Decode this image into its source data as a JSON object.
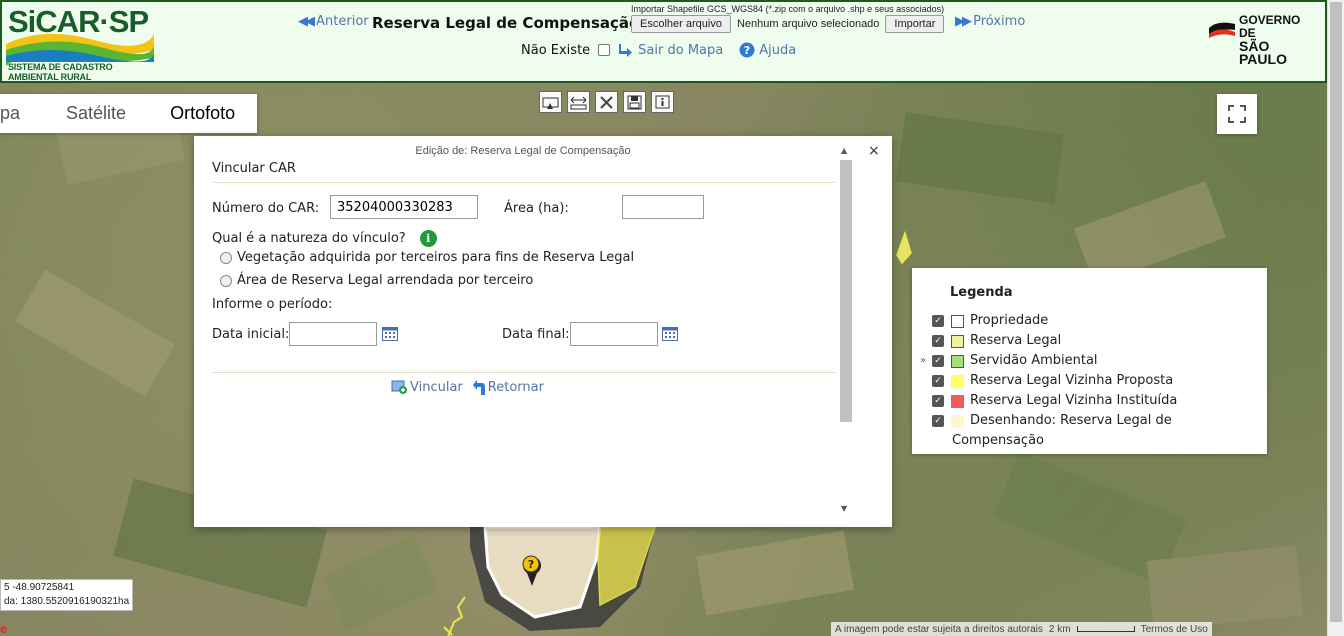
{
  "header": {
    "logo_title": "SiCAR·SP",
    "logo_subtitle": "SISTEMA DE CADASTRO AMBIENTAL RURAL",
    "anterior_label": "Anterior",
    "page_title": "Reserva Legal de Compensação",
    "import_hint": "Importar Shapefile GCS_WGS84 (*.zip com o arquivo .shp e seus associados)",
    "choose_file_label": "Escolher arquivo",
    "file_status": "Nenhum arquivo selecionado",
    "import_label": "Importar",
    "proximo_label": "Próximo",
    "nao_existe_label": "Não Existe",
    "sair_label": "Sair do Mapa",
    "ajuda_label": "Ajuda",
    "gov_line1": "GOVERNO DE",
    "gov_line2": "SÃO PAULO"
  },
  "map": {
    "types": [
      "pa",
      "Satélite",
      "Ortofoto"
    ],
    "active_type": "Ortofoto",
    "tools": [
      "select-icon",
      "measure-icon",
      "delete-icon",
      "save-icon",
      "info-icon"
    ],
    "coord_line1": "5 -48.90725841",
    "coord_line2": "da: 1380.5520916190321ha",
    "attribution": "A imagem pode estar sujeita a direitos autorais",
    "scale_label": "2 km",
    "terms": "Termos de Uso",
    "google_mark": "e"
  },
  "dialog": {
    "title": "Edição de: Reserva Legal de Compensação",
    "close": "×",
    "section": "Vincular CAR",
    "numero_car_label": "Número do CAR:",
    "numero_car_value": "35204000330283",
    "area_label": "Área (ha):",
    "area_value": "",
    "natureza_label": "Qual é a natureza do vínculo?",
    "option1": "Vegetação adquirida por terceiros para fins de Reserva Legal",
    "option2": "Área de Reserva Legal arrendada por terceiro",
    "periodo_label": "Informe o período:",
    "data_inicial_label": "Data inicial:",
    "data_final_label": "Data final:",
    "vincular_label": "Vincular",
    "retornar_label": "Retornar"
  },
  "legend": {
    "title": "Legenda",
    "items": [
      {
        "label": "Propriedade",
        "color": "#ffffff",
        "checked": true
      },
      {
        "label": "Reserva Legal",
        "color": "#eef2a0",
        "checked": true
      },
      {
        "label": "Servidão Ambiental",
        "color": "#a6e07a",
        "checked": true
      },
      {
        "label": "Reserva Legal Vizinha Proposta",
        "color": "#ffff66",
        "checked": true
      },
      {
        "label": "Reserva Legal Vizinha Instituída",
        "color": "#f15a5a",
        "checked": true
      },
      {
        "label": "Desenhando: Reserva Legal de",
        "label2": "Compensação",
        "color": "#fff6cf",
        "checked": true
      }
    ]
  }
}
